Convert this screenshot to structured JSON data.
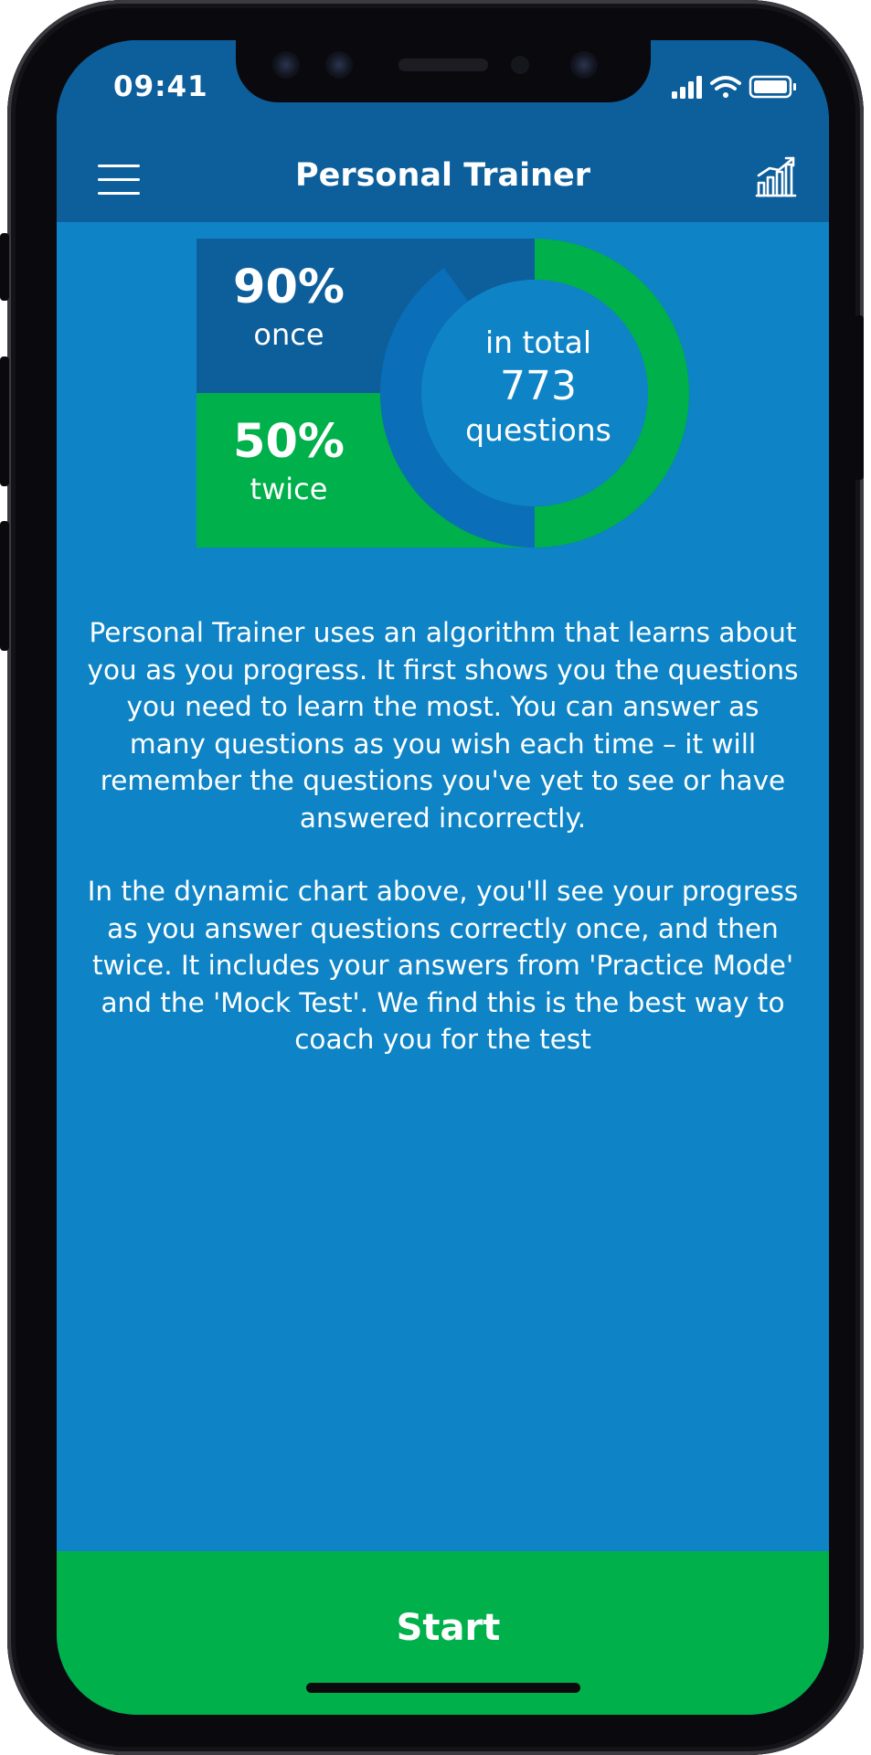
{
  "status_bar": {
    "time": "09:41",
    "icons": [
      "signal-icon",
      "wifi-icon",
      "battery-icon"
    ]
  },
  "header": {
    "title": "Personal Trainer",
    "left_icon": "hamburger-menu-icon",
    "right_icon": "bar-chart-icon"
  },
  "progress": {
    "once": {
      "percent_label": "90%",
      "label": "once",
      "value": 0.9
    },
    "twice": {
      "percent_label": "50%",
      "label": "twice",
      "value": 0.5
    },
    "total": {
      "prefix": "in total",
      "count": "773",
      "suffix": "questions"
    }
  },
  "description": {
    "paragraph1": "Personal Trainer uses an algorithm that learns about you as you progress. It first shows you the questions you need to learn the most. You can answer as many questions as you wish each time – it will remember the questions you've yet to see or have answered incorrectly.",
    "paragraph2": "In the dynamic chart above, you'll see your progress as you answer questions correctly once, and then twice. It includes your answers from 'Practice Mode' and the 'Mock Test'. We find this is the best way to coach you for the test"
  },
  "footer": {
    "start_label": "Start"
  },
  "colors": {
    "header_bg": "#0d5f9c",
    "screen_bg": "#0e84c6",
    "box_once": "#0d5f9c",
    "box_twice": "#00b04b",
    "ring_once": "#0a6fb8",
    "ring_twice": "#00b04b",
    "ring_track": "#0d5f9c",
    "center_fill": "#0e84c6",
    "start_bg": "#00b04b"
  }
}
